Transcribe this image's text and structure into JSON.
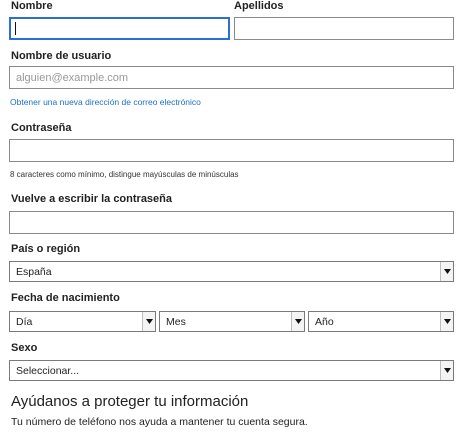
{
  "form": {
    "first_name": {
      "label": "Nombre",
      "value": ""
    },
    "last_name": {
      "label": "Apellidos",
      "value": ""
    },
    "username": {
      "label": "Nombre de usuario",
      "placeholder": "alguien@example.com",
      "link": "Obtener una nueva dirección de correo electrónico"
    },
    "password": {
      "label": "Contraseña",
      "hint": "8 caracteres como mínimo, distingue mayúsculas de minúsculas"
    },
    "password_confirm": {
      "label": "Vuelve a escribir la contraseña"
    },
    "country": {
      "label": "País o región",
      "selected": "España"
    },
    "birthdate": {
      "label": "Fecha de nacimiento",
      "day": "Día",
      "month": "Mes",
      "year": "Año"
    },
    "gender": {
      "label": "Sexo",
      "selected": "Seleccionar..."
    }
  },
  "security": {
    "heading": "Ayúdanos a proteger tu información",
    "description": "Tu número de teléfono nos ayuda a mantener tu cuenta segura."
  },
  "icons": {
    "dropdown": "triangle-down-icon"
  }
}
